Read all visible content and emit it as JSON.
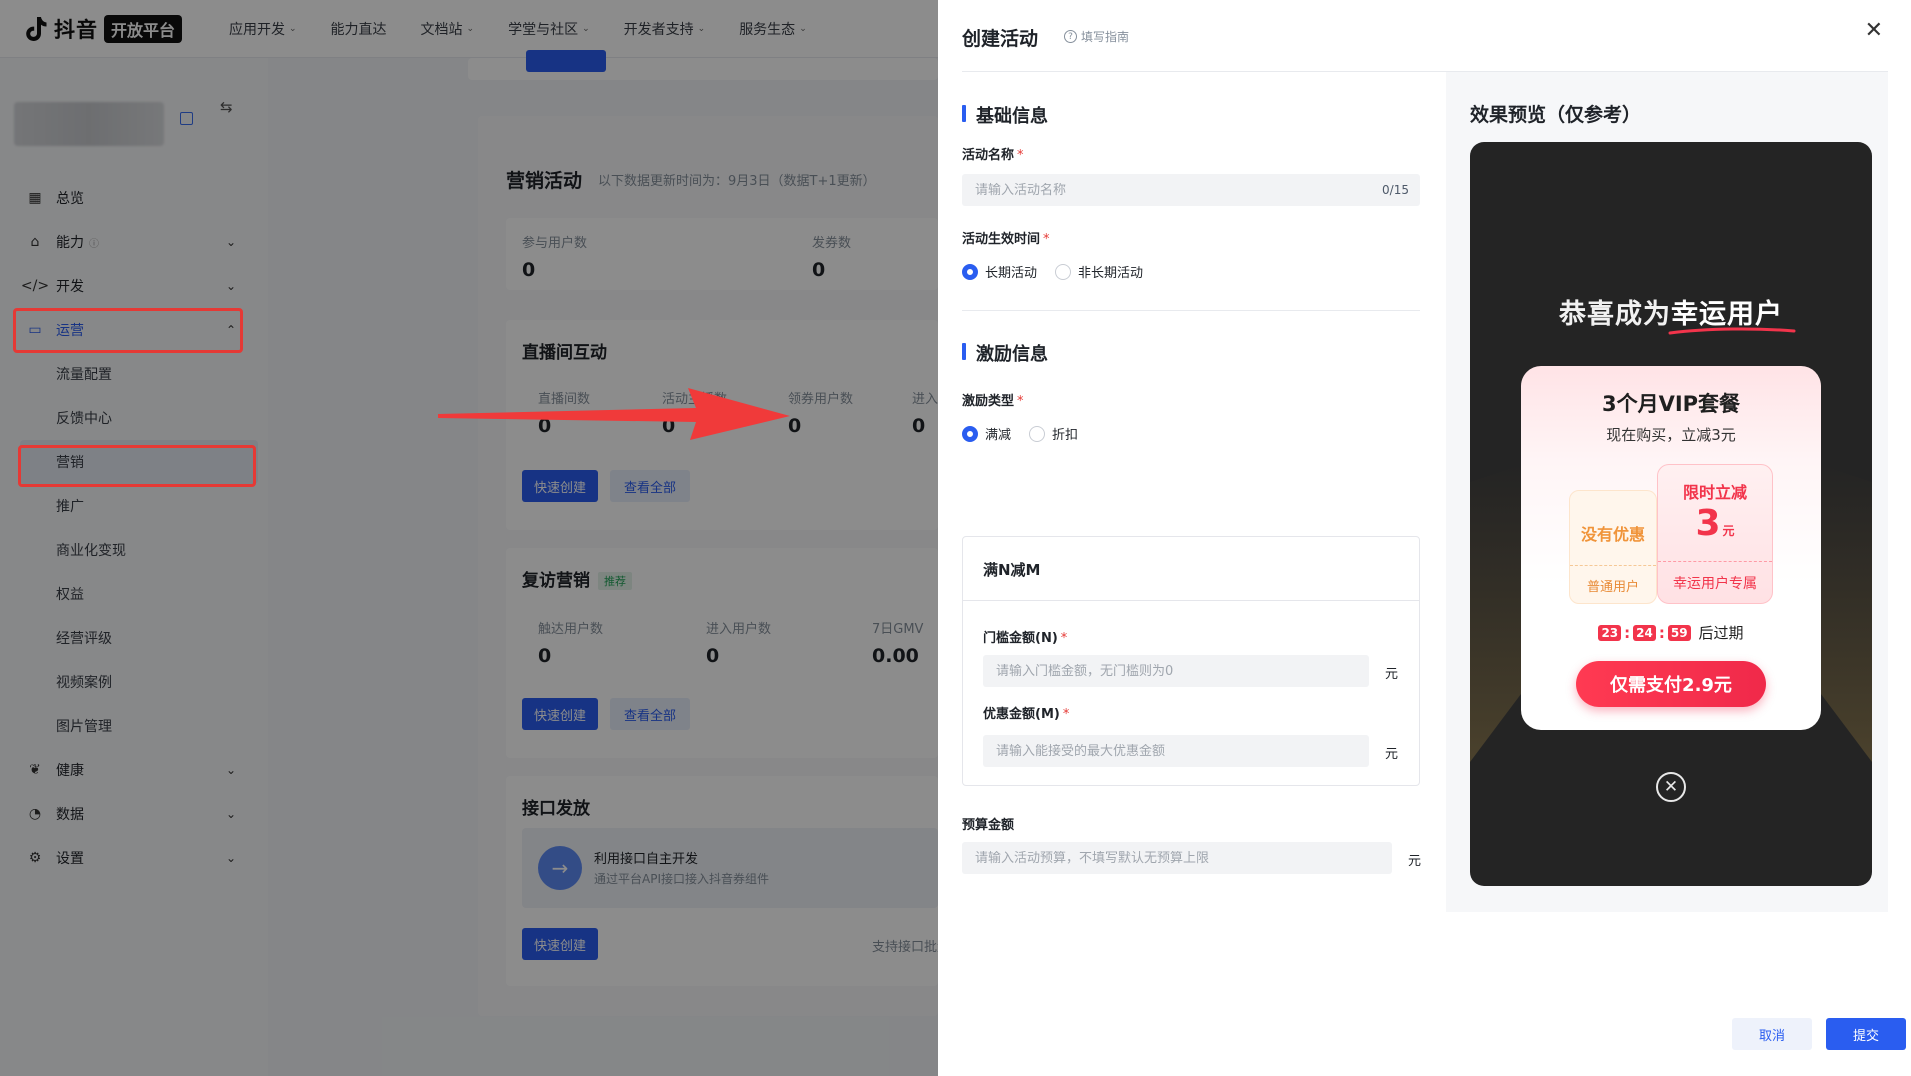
{
  "topnav": {
    "logo_text": "抖音",
    "logo_badge": "开放平台",
    "menu": [
      "应用开发",
      "能力直达",
      "文档站",
      "学堂与社区",
      "开发者支持",
      "服务生态"
    ]
  },
  "sidebar": {
    "items": [
      {
        "label": "总览",
        "icon": "dashboard-icon"
      },
      {
        "label": "能力",
        "icon": "capability-icon"
      },
      {
        "label": "开发",
        "icon": "code-icon"
      },
      {
        "label": "运营",
        "icon": "operation-icon"
      },
      {
        "label": "健康",
        "icon": "health-icon"
      },
      {
        "label": "数据",
        "icon": "chart-icon"
      },
      {
        "label": "设置",
        "icon": "settings-icon"
      }
    ],
    "operation_sub": [
      "流量配置",
      "反馈中心",
      "营销",
      "推广",
      "商业化变现",
      "权益",
      "经营评级",
      "视频案例",
      "图片管理"
    ]
  },
  "main": {
    "marketing_title": "营销活动",
    "marketing_note": "以下数据更新时间为：9月3日（数据T+1更新）",
    "top_metrics": [
      {
        "label": "参与用户数",
        "value": "0"
      },
      {
        "label": "发券数",
        "value": "0"
      }
    ],
    "live_title": "直播间互动",
    "live_metrics": [
      {
        "label": "直播间数",
        "value": "0"
      },
      {
        "label": "活动主播数",
        "value": "0"
      },
      {
        "label": "领券用户数",
        "value": "0"
      },
      {
        "label": "进入",
        "value": "0"
      }
    ],
    "revisit_title": "复访营销",
    "revisit_tag": "推荐",
    "revisit_metrics": [
      {
        "label": "触达用户数",
        "value": "0"
      },
      {
        "label": "进入用户数",
        "value": "0"
      },
      {
        "label": "7日GMV",
        "value": "0.00"
      }
    ],
    "api_title": "接口发放",
    "api_row_title": "利用接口自主开发",
    "api_row_desc": "通过平台API接口接入抖音券组件",
    "api_note": "支持接口批量",
    "quick_create": "快速创建",
    "view_all": "查看全部"
  },
  "drawer": {
    "title": "创建活动",
    "guide": "填写指南",
    "basic_title": "基础信息",
    "name_label": "活动名称",
    "name_placeholder": "请输入活动名称",
    "name_count": "0/15",
    "time_label": "活动生效时间",
    "time_options": [
      "长期活动",
      "非长期活动"
    ],
    "incentive_title": "激励信息",
    "type_label": "激励类型",
    "type_options": [
      "满减",
      "折扣"
    ],
    "rule_title": "满N减M",
    "threshold_label": "门槛金额(N)",
    "threshold_placeholder": "请输入门槛金额，无门槛则为0",
    "discount_label": "优惠金额(M)",
    "discount_placeholder": "请输入能接受的最大优惠金额",
    "budget_label": "预算金额",
    "budget_placeholder": "请输入活动预算，不填写默认无预算上限",
    "unit": "元",
    "preview_title": "效果预览（仅参考）",
    "cancel": "取消",
    "submit": "提交"
  },
  "preview": {
    "congrats_prefix": "恭喜成为",
    "congrats_highlight": "幸运用户",
    "card_title": "3个月VIP套餐",
    "card_sub": "现在购买，立减3元",
    "no_discount": "没有优惠",
    "normal_user": "普通用户",
    "limit_title": "限时立减",
    "limit_amount": "3",
    "limit_unit": "元",
    "lucky_user": "幸运用户专属",
    "timer": [
      "23",
      "24",
      "59"
    ],
    "expire_text": "后过期",
    "pay_button": "仅需支付2.9元"
  }
}
